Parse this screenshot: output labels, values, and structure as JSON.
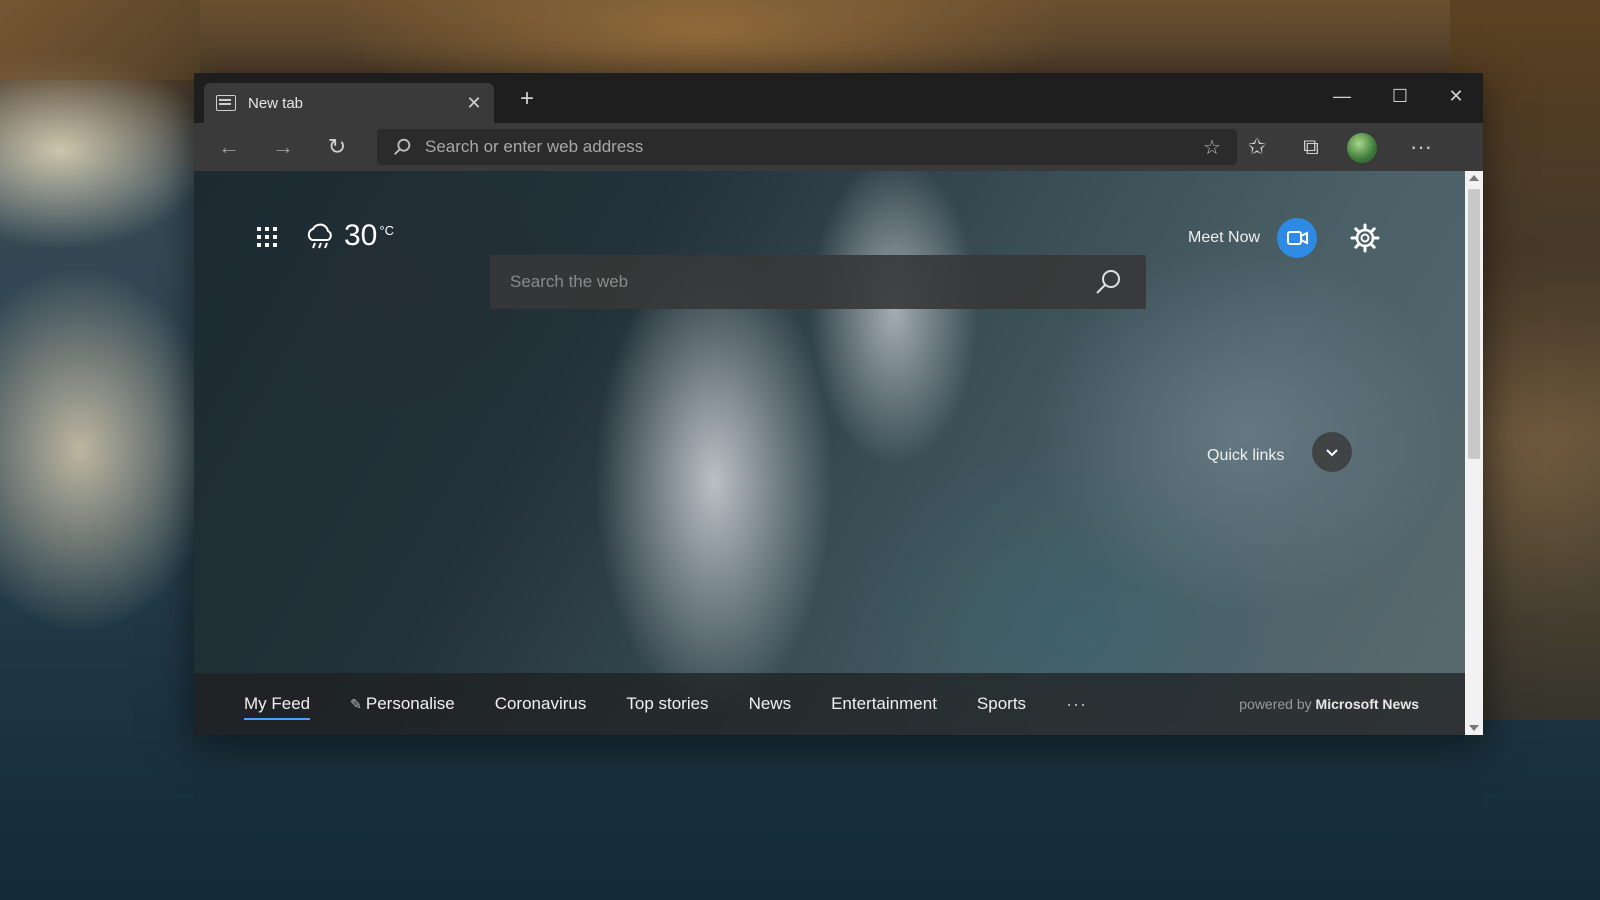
{
  "browser": {
    "tab": {
      "title": "New tab",
      "icon": "newtab-page-icon",
      "close_glyph": "✕"
    },
    "new_tab_glyph": "+",
    "window_controls": {
      "minimize": "—",
      "maximize": "☐",
      "close": "✕"
    },
    "toolbar": {
      "back_glyph": "←",
      "forward_glyph": "→",
      "refresh_glyph": "↻",
      "address_placeholder": "Search or enter web address",
      "favorite_glyph": "☆",
      "favorites_glyph": "✩",
      "collections_glyph": "⧉",
      "menu_glyph": "···"
    }
  },
  "page": {
    "weather": {
      "temperature": "30",
      "unit": "°C",
      "icon": "rain-cloud-icon"
    },
    "meet_now": {
      "label": "Meet Now",
      "color": "#2f8ae3"
    },
    "search": {
      "placeholder": "Search the web"
    },
    "quick_links": {
      "label": "Quick links"
    },
    "news_nav": {
      "items": [
        "My Feed",
        "Personalise",
        "Coronavirus",
        "Top stories",
        "News",
        "Entertainment",
        "Sports"
      ],
      "active": "My Feed",
      "more_glyph": "···",
      "powered_prefix": "powered by",
      "powered_brand": "Microsoft News",
      "accent": "#4aa0ff"
    }
  }
}
